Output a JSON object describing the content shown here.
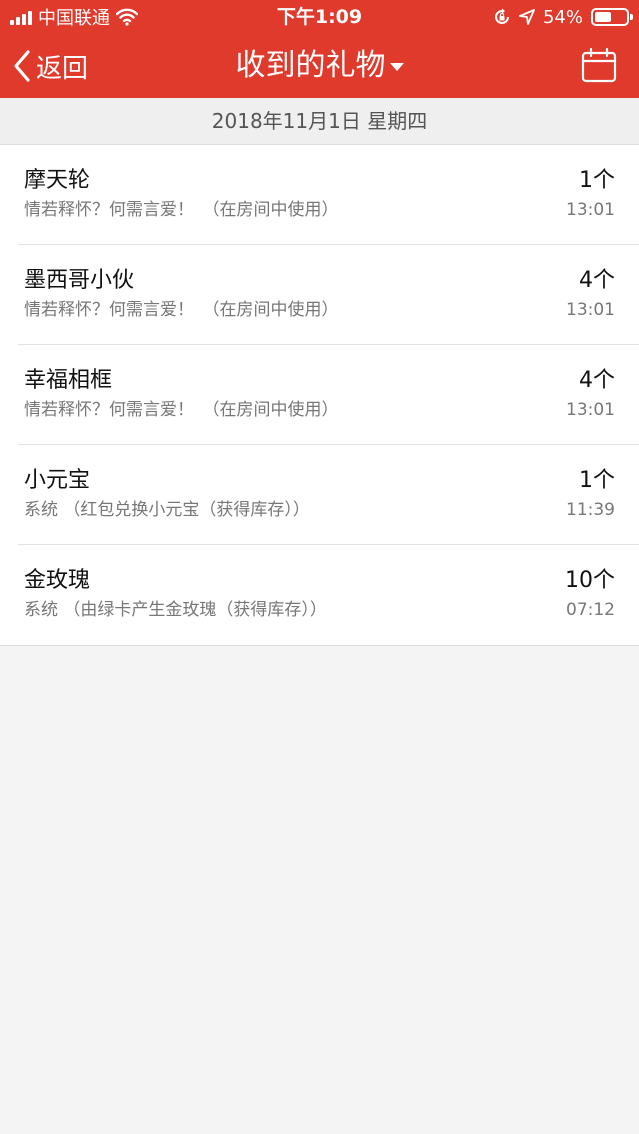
{
  "status_bar": {
    "carrier": "中国联通",
    "time": "下午1:09",
    "battery": "54%",
    "battery_level": 0.54,
    "icons": [
      "signal-icon",
      "wifi-icon",
      "orientation-lock-icon",
      "location-icon",
      "battery-icon"
    ]
  },
  "navbar": {
    "back_label": "返回",
    "title": "收到的礼物",
    "icons": [
      "back-chevron-icon",
      "dropdown-caret-icon",
      "calendar-icon"
    ]
  },
  "date": "2018年11月1日 星期四",
  "gifts": [
    {
      "name": "摩天轮",
      "desc": "情若释怀？何需言爱！　（在房间中使用）",
      "count": "1个",
      "time": "13:01"
    },
    {
      "name": "墨西哥小伙",
      "desc": "情若释怀？何需言爱！　（在房间中使用）",
      "count": "4个",
      "time": "13:01"
    },
    {
      "name": "幸福相框",
      "desc": "情若释怀？何需言爱！　（在房间中使用）",
      "count": "4个",
      "time": "13:01"
    },
    {
      "name": "小元宝",
      "desc": "系统 （红包兑换小元宝（获得库存））",
      "count": "1个",
      "time": "11:39"
    },
    {
      "name": "金玫瑰",
      "desc": "系统 （由绿卡产生金玫瑰（获得库存））",
      "count": "10个",
      "time": "07:12"
    }
  ],
  "colors": {
    "header_red": "#df3a2c",
    "background": "#f4f4f4"
  }
}
